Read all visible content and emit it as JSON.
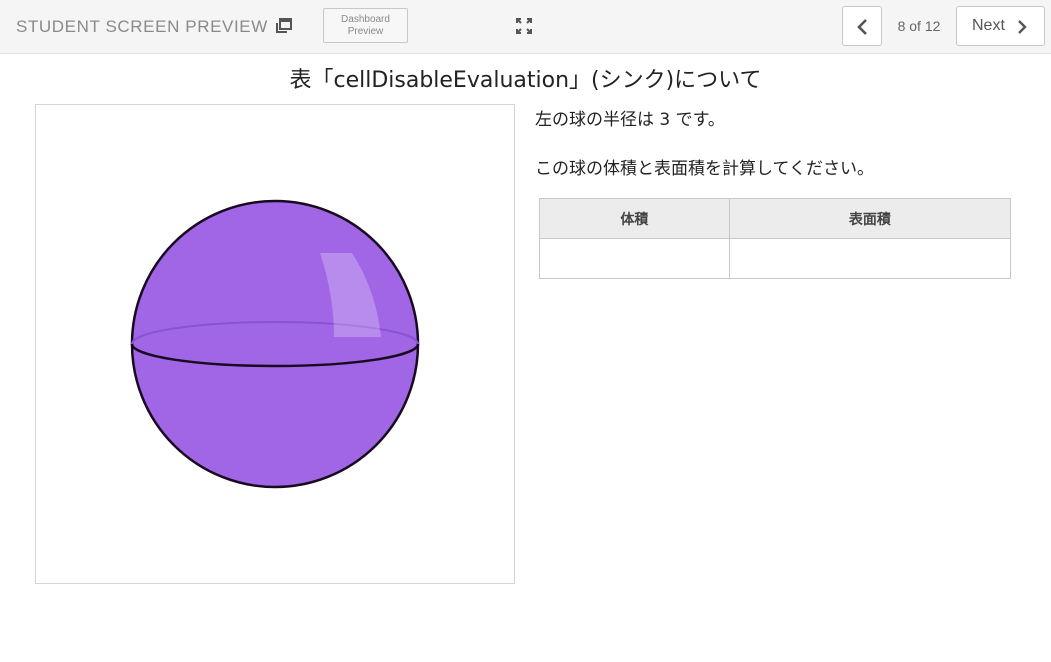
{
  "header": {
    "preview_label": "STUDENT SCREEN PREVIEW",
    "popout_icon": "popout-window-icon",
    "dashboard_line1": "Dashboard",
    "dashboard_line2": "Preview",
    "expand_icon": "expand-arrows-icon",
    "prev_icon": "chevron-left-icon",
    "page_counter": "8 of 12",
    "next_label": "Next",
    "next_icon": "chevron-right-icon"
  },
  "question": {
    "title": "表「cellDisableEvaluation」(シンク)について",
    "line1": "左の球の半径は 3 です。",
    "line2": "この球の体積と表面積を計算してください。"
  },
  "figure": {
    "shape": "sphere",
    "fill_color": "#a066e6",
    "stroke_color": "#1a0a1f"
  },
  "table": {
    "headers": [
      "体積",
      "表面積"
    ],
    "cells": [
      "",
      ""
    ]
  },
  "colors": {
    "topbar_bg": "#f5f5f5",
    "accent": "#a066e6"
  }
}
